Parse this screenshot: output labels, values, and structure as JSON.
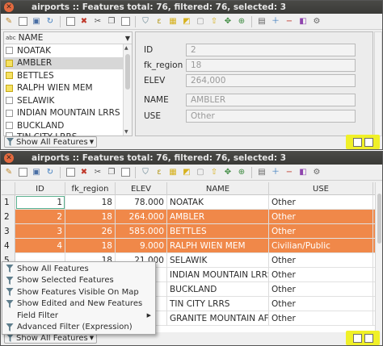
{
  "colors": {
    "selection": "#f08849",
    "highlight_marker": "#f0f028",
    "title_bar": "#3c3b37",
    "selected_checkbox": "#f6e262"
  },
  "form_window": {
    "title": "airports :: Features total: 76, filtered: 76, selected: 3",
    "toolbar_icons": [
      "pencil-icon",
      "multi-edit-icon",
      "save-icon",
      "reload-icon",
      "add-feature-icon",
      "delete-icon",
      "cut-icon",
      "copy-icon",
      "paste-icon",
      "filter-expression-icon",
      "select-by-expression-icon",
      "select-all-icon",
      "invert-selection-icon",
      "deselect-icon",
      "move-selection-top-icon",
      "pan-to-selection-icon",
      "zoom-to-selection-icon",
      "field-calculator-icon",
      "new-field-icon",
      "delete-field-icon",
      "conditional-formatting-icon",
      "actions-icon"
    ],
    "list_header": {
      "type_badge": "abc",
      "label": "NAME"
    },
    "features": [
      {
        "name": "NOATAK",
        "selected": false
      },
      {
        "name": "AMBLER",
        "selected": true,
        "current": true
      },
      {
        "name": "BETTLES",
        "selected": true
      },
      {
        "name": "RALPH WIEN MEM",
        "selected": true
      },
      {
        "name": "SELAWIK",
        "selected": false
      },
      {
        "name": "INDIAN MOUNTAIN LRRS",
        "selected": false
      },
      {
        "name": "BUCKLAND",
        "selected": false
      },
      {
        "name": "TIN CITY LRRS",
        "selected": false
      }
    ],
    "form_fields": [
      {
        "label": "ID",
        "value": "2"
      },
      {
        "label": "fk_region",
        "value": "18"
      },
      {
        "label": "ELEV",
        "value": "264,000"
      },
      {
        "label": "NAME",
        "value": "AMBLER"
      },
      {
        "label": "USE",
        "value": "Other"
      }
    ],
    "filter_button": "Show All Features"
  },
  "table_window": {
    "title": "airports :: Features total: 76, filtered: 76, selected: 3",
    "columns": [
      "ID",
      "fk_region",
      "ELEV",
      "NAME",
      "USE"
    ],
    "rows": [
      {
        "rowhead": "1",
        "id": "1",
        "fk_region": "18",
        "elev": "78.000",
        "name": "NOATAK",
        "use": "Other",
        "selected": false
      },
      {
        "rowhead": "2",
        "id": "2",
        "fk_region": "18",
        "elev": "264.000",
        "name": "AMBLER",
        "use": "Other",
        "selected": true
      },
      {
        "rowhead": "3",
        "id": "3",
        "fk_region": "26",
        "elev": "585.000",
        "name": "BETTLES",
        "use": "Other",
        "selected": true
      },
      {
        "rowhead": "4",
        "id": "4",
        "fk_region": "18",
        "elev": "9.000",
        "name": "RALPH WIEN MEM",
        "use": "Civilian/Public",
        "selected": true
      },
      {
        "rowhead": "5",
        "id": "",
        "fk_region": "18",
        "elev": "21.000",
        "name": "SELAWIK",
        "use": "Other",
        "selected": false
      },
      {
        "rowhead": "",
        "id": "",
        "fk_region": "",
        "elev": "",
        "name": "INDIAN MOUNTAIN LRRS",
        "use": "Other",
        "selected": false
      },
      {
        "rowhead": "",
        "id": "",
        "fk_region": "",
        "elev": "",
        "name": "BUCKLAND",
        "use": "Other",
        "selected": false
      },
      {
        "rowhead": "",
        "id": "",
        "fk_region": "",
        "elev": "",
        "name": "TIN CITY LRRS",
        "use": "Other",
        "selected": false
      },
      {
        "rowhead": "",
        "id": "",
        "fk_region": "",
        "elev": "",
        "name": "GRANITE MOUNTAIN AFS",
        "use": "Other",
        "selected": false
      }
    ],
    "filter_menu": [
      {
        "label": "Show All Features",
        "icon": true
      },
      {
        "label": "Show Selected Features",
        "icon": true
      },
      {
        "label": "Show Features Visible On Map",
        "icon": true
      },
      {
        "label": "Show Edited and New Features",
        "icon": true
      },
      {
        "label": "Field Filter",
        "icon": false,
        "submenu": true
      },
      {
        "label": "Advanced Filter (Expression)",
        "icon": true
      }
    ],
    "filter_button": "Show All Features"
  }
}
